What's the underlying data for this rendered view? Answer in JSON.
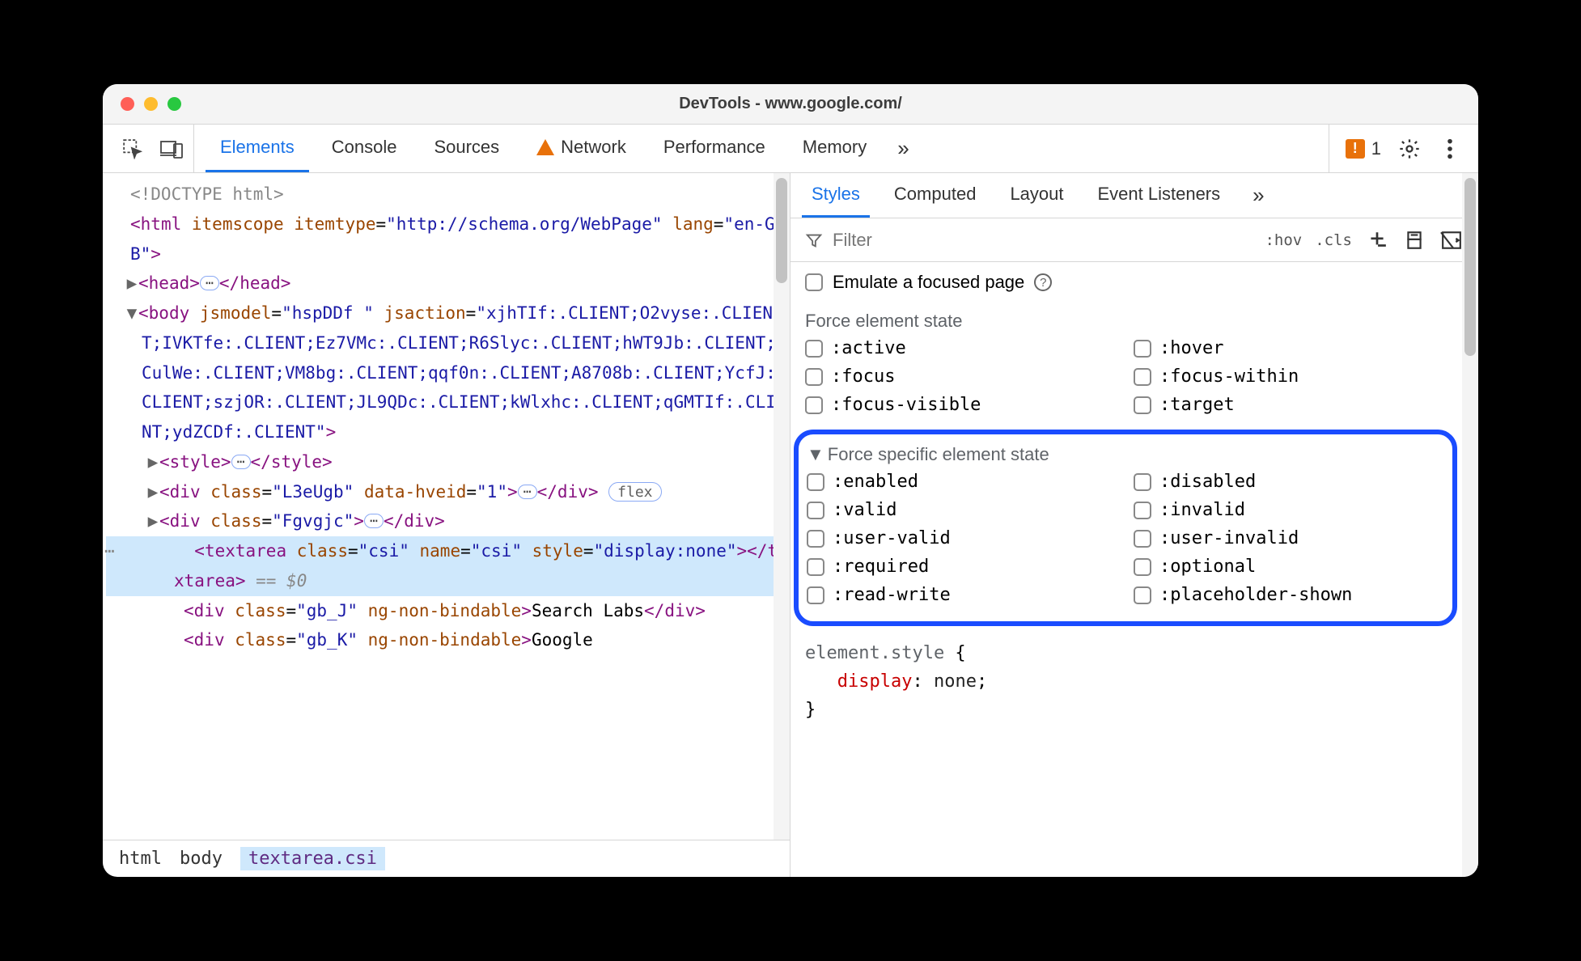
{
  "titlebar": {
    "title": "DevTools - www.google.com/"
  },
  "toolbar": {
    "tabs": [
      "Elements",
      "Console",
      "Sources",
      "Network",
      "Performance",
      "Memory"
    ],
    "active_tab": "Elements",
    "issue_count": "1"
  },
  "dom": {
    "doctype": "<!DOCTYPE html>",
    "html_open": "<html itemscope itemtype=\"http://schema.org/WebPage\" lang=\"en-GB\">",
    "head": {
      "open": "<head>",
      "close": "</head>"
    },
    "body_open": "<body jsmodel=\"hspDDf \" jsaction=\"xjhTIf:.CLIENT;O2vyse:.CLIENT;IVKTfe:.CLIENT;Ez7VMc:.CLIENT;R6Slyc:.CLIENT;hWT9Jb:.CLIENT;WCulWe:.CLIENT;VM8bg:.CLIENT;qqf0n:.CLIENT;A8708b:.CLIENT;YcfJ:.CLIENT;szjOR:.CLIENT;JL9QDc:.CLIENT;kWlxhc:.CLIENT;qGMTIf:.CLIENT;ydZCDf:.CLIENT\">",
    "style": {
      "open": "<style>",
      "close": "</style>"
    },
    "div1": {
      "open": "<div class=\"L3eUgb\" data-hveid=\"1\">",
      "close": "</div>",
      "badge": "flex"
    },
    "div2": {
      "open": "<div class=\"Fgvgjc\">",
      "close": "</div>"
    },
    "textarea": {
      "full": "<textarea class=\"csi\" name=\"csi\" style=\"display:none\"></textarea>",
      "suffix": " == $0"
    },
    "div3": {
      "full": "<div class=\"gb_J\" ng-non-bindable>Search Labs</div>"
    },
    "div4": {
      "full": "<div class=\"gb_K\" ng-non-bindable>Google"
    }
  },
  "breadcrumb": [
    "html",
    "body",
    "textarea.csi"
  ],
  "styles_tabs": [
    "Styles",
    "Computed",
    "Layout",
    "Event Listeners"
  ],
  "styles_active": "Styles",
  "styles_toolbar": {
    "filter_placeholder": "Filter",
    "hov": ":hov",
    "cls": ".cls"
  },
  "emulate": {
    "label": "Emulate a focused page"
  },
  "force_state": {
    "header": "Force element state",
    "items": [
      ":active",
      ":hover",
      ":focus",
      ":focus-within",
      ":focus-visible",
      ":target"
    ]
  },
  "force_specific": {
    "header": "Force specific element state",
    "items": [
      ":enabled",
      ":disabled",
      ":valid",
      ":invalid",
      ":user-valid",
      ":user-invalid",
      ":required",
      ":optional",
      ":read-write",
      ":placeholder-shown"
    ]
  },
  "style_rule": {
    "selector": "element.style",
    "brace_open": " {",
    "prop": "display",
    "colon": ": ",
    "val": "none",
    "semi": ";",
    "brace_close": "}"
  }
}
